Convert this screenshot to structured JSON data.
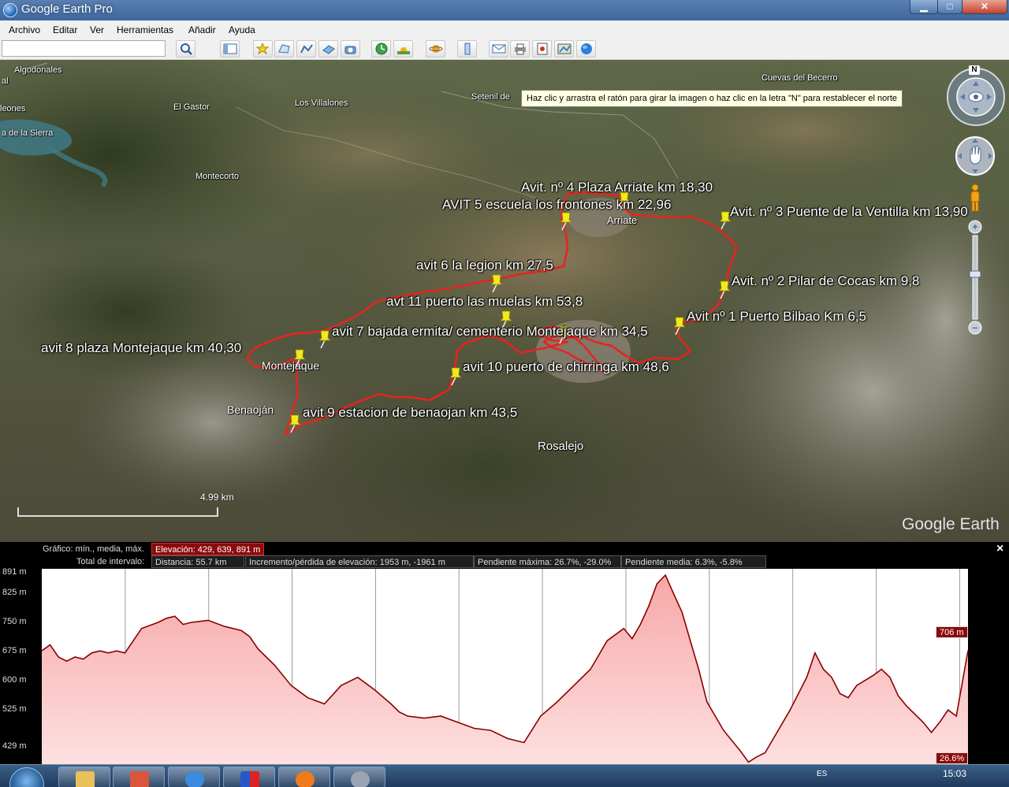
{
  "window": {
    "title": "Google Earth Pro"
  },
  "menu": [
    "Archivo",
    "Editar",
    "Ver",
    "Herramientas",
    "Añadir",
    "Ayuda"
  ],
  "search": {
    "value": "",
    "placeholder": ""
  },
  "tooltip": "Haz clic y arrastra el ratón para girar la imagen o haz clic en la letra \"N\" para restablecer el norte",
  "places": [
    {
      "name": "Algodonales"
    },
    {
      "name": "al"
    },
    {
      "name": "leones"
    },
    {
      "name": "El Gastor"
    },
    {
      "name": "Los Villalones"
    },
    {
      "name": "Setenil de"
    },
    {
      "name": "Cuevas del Becerro"
    },
    {
      "name": "a de la Sierra"
    },
    {
      "name": "Montecorto"
    },
    {
      "name": "Arriate"
    },
    {
      "name": "Montejaque"
    },
    {
      "name": "Benaoján"
    },
    {
      "name": "Rosalejo"
    }
  ],
  "markers": [
    {
      "label": "Avit. nº 4 Plaza Arriate km 18,30"
    },
    {
      "label": "AVIT 5 escuela los frontones km 22,96"
    },
    {
      "label": "Avit. nº 3 Puente de la Ventilla km 13,90"
    },
    {
      "label": "avit 6 la legion km 27,5"
    },
    {
      "label": "Avit. nº 2 Pilar de Cocas km 9,8"
    },
    {
      "label": "avt 11 puerto las muelas km 53,8"
    },
    {
      "label": "Avit nº 1 Puerto Bilbao Km 6,5"
    },
    {
      "label": "avit 7 bajada ermita/ cementerio Montejaque km 34,5"
    },
    {
      "label": "avit 8 plaza Montejaque km 40,30"
    },
    {
      "label": "avit 10 puerto de chirringa km 48,6"
    },
    {
      "label": "avit 9 estacion de benaojan km 43,5"
    }
  ],
  "map": {
    "scale_label": "4.99 km",
    "watermark": "Google Earth",
    "north_letter": "N",
    "route_color": "#e8231f"
  },
  "profile": {
    "graph_label": "Gráfico: mín., media, máx.",
    "elevation": "Elevación: 429, 639, 891 m",
    "range_label": "Total de intervalo:",
    "distance": "Distancia: 55.7 km",
    "gain_loss": "Incremento/pérdida de elevación: 1953 m, -1961 m",
    "max_slope": "Pendiente máxima: 26.7%, -29.0%",
    "avg_slope": "Pendiente media: 6.3%, -5.8%",
    "close": "×",
    "current_elevation": "706 m",
    "current_slope": "26.6%"
  },
  "chart_data": {
    "type": "area",
    "title": "",
    "xlabel": "",
    "ylabel": "",
    "y_ticks": [
      "891 m",
      "825 m",
      "750 m",
      "675 m",
      "600 m",
      "525 m",
      "429 m"
    ],
    "ylim": [
      429,
      891
    ],
    "xlim": [
      0,
      55.7
    ],
    "x_unit": "km",
    "series": [
      {
        "x": [
          0,
          0.5,
          1.0,
          1.5,
          2.0,
          2.5,
          3.0,
          3.5,
          4.0,
          4.5,
          5.0,
          6.0,
          7.0,
          7.5,
          8.0,
          8.5,
          9.0,
          10.0,
          11.0,
          12.0,
          12.5,
          13.0,
          13.5,
          14.0,
          15.0,
          16.0,
          17.0,
          18.0,
          19.0,
          20.0,
          21.0,
          21.5,
          22.0,
          23.0,
          24.0,
          25.0,
          26.0,
          27.0,
          28.0,
          29.0,
          30.0,
          31.0,
          32.0,
          33.0,
          34.0,
          35.0,
          35.5,
          36.0,
          36.5,
          37.0,
          37.5,
          38.0,
          38.5,
          39.0,
          39.5,
          40.0,
          41.0,
          42.0,
          42.5,
          43.0,
          43.5,
          44.0,
          45.0,
          46.0,
          46.5,
          47.0,
          47.5,
          48.0,
          48.5,
          49.0,
          50.0,
          50.5,
          51.0,
          51.5,
          52.0,
          53.0,
          53.5,
          54.0,
          54.5,
          55.0,
          55.7
        ],
        "values": [
          705,
          720,
          690,
          680,
          690,
          685,
          700,
          705,
          700,
          705,
          700,
          760,
          775,
          785,
          790,
          770,
          775,
          780,
          765,
          755,
          740,
          710,
          690,
          670,
          620,
          590,
          575,
          620,
          640,
          610,
          575,
          555,
          545,
          540,
          545,
          530,
          515,
          510,
          490,
          480,
          545,
          580,
          620,
          660,
          730,
          760,
          735,
          770,
          815,
          870,
          891,
          845,
          800,
          730,
          660,
          580,
          510,
          460,
          432,
          445,
          455,
          490,
          560,
          640,
          700,
          660,
          640,
          600,
          590,
          620,
          645,
          660,
          640,
          595,
          570,
          530,
          505,
          530,
          560,
          545,
          706
        ]
      }
    ]
  }
}
